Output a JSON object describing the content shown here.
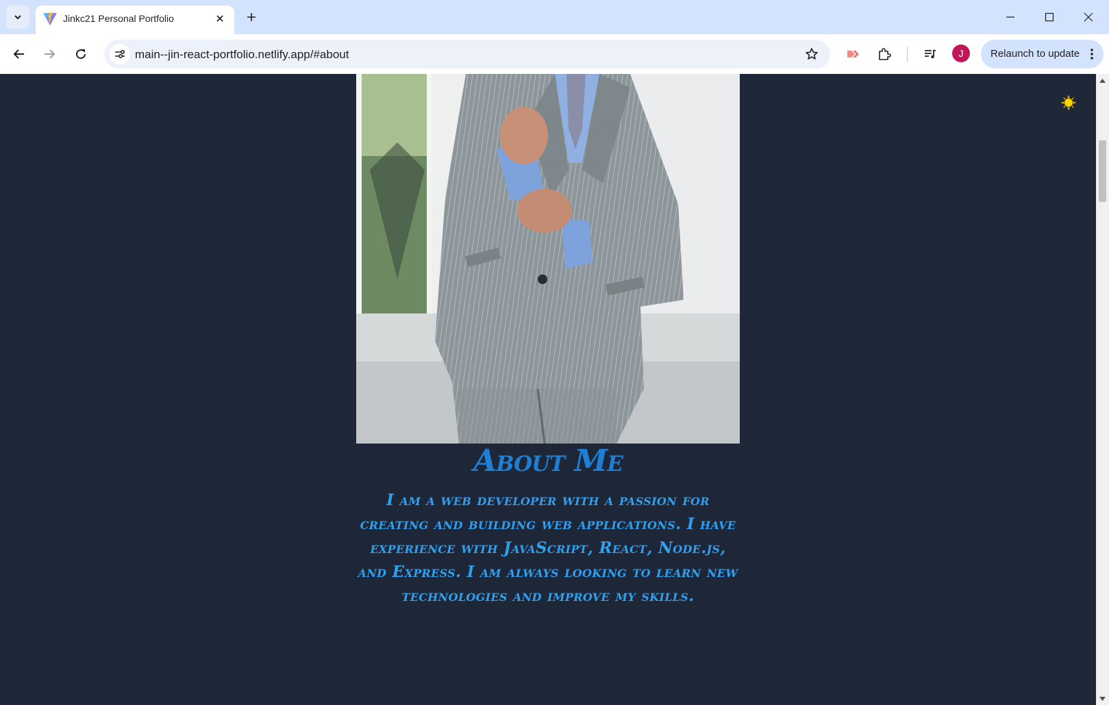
{
  "browser": {
    "tab_title": "Jinkc21 Personal Portfolio",
    "url": "main--jin-react-portfolio.netlify.app/#about",
    "profile_initial": "J",
    "relaunch_label": "Relaunch to update",
    "icons": [
      "tab-search-icon",
      "vite-favicon",
      "close-icon",
      "plus-icon",
      "minimize-icon",
      "maximize-icon",
      "close-window-icon",
      "back-arrow-icon",
      "forward-arrow-icon",
      "reload-icon",
      "site-info-icon",
      "star-icon",
      "extension-icon",
      "puzzle-icon",
      "media-queue-icon",
      "more-vert-icon"
    ]
  },
  "page": {
    "about_title": "About Me",
    "about_text": "I am a web developer with a passion for creating and building web applications. I have experience with JavaScript, React, Node.js, and Express. I am always looking to learn new technologies and improve my skills.",
    "theme_toggle_icon": "sun-icon"
  },
  "colors": {
    "page_background": "#1e2738",
    "heading": "#1e7fd4",
    "body_text": "#2f9ff0",
    "tabbar": "#d3e3fd"
  }
}
